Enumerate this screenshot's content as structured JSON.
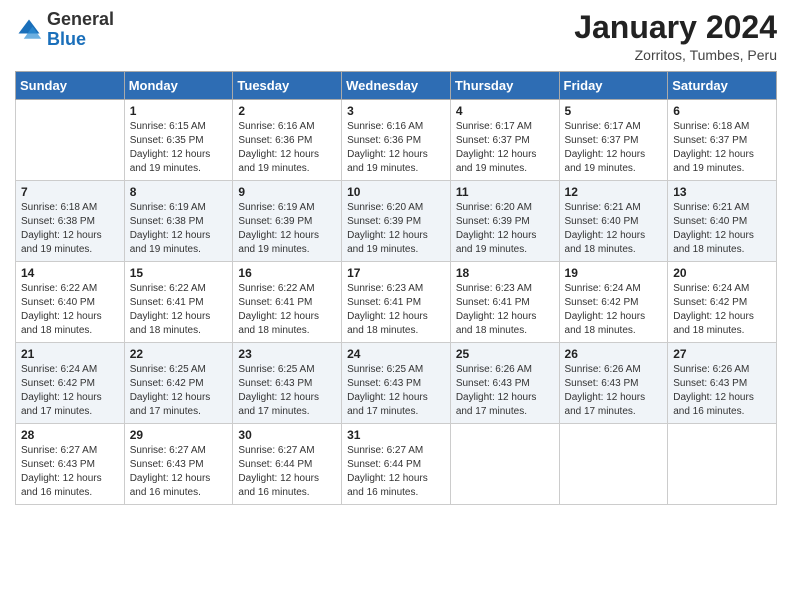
{
  "header": {
    "logo_general": "General",
    "logo_blue": "Blue",
    "month_title": "January 2024",
    "location": "Zorritos, Tumbes, Peru"
  },
  "weekdays": [
    "Sunday",
    "Monday",
    "Tuesday",
    "Wednesday",
    "Thursday",
    "Friday",
    "Saturday"
  ],
  "weeks": [
    [
      {
        "day": "",
        "info": ""
      },
      {
        "day": "1",
        "info": "Sunrise: 6:15 AM\nSunset: 6:35 PM\nDaylight: 12 hours and 19 minutes."
      },
      {
        "day": "2",
        "info": "Sunrise: 6:16 AM\nSunset: 6:36 PM\nDaylight: 12 hours and 19 minutes."
      },
      {
        "day": "3",
        "info": "Sunrise: 6:16 AM\nSunset: 6:36 PM\nDaylight: 12 hours and 19 minutes."
      },
      {
        "day": "4",
        "info": "Sunrise: 6:17 AM\nSunset: 6:37 PM\nDaylight: 12 hours and 19 minutes."
      },
      {
        "day": "5",
        "info": "Sunrise: 6:17 AM\nSunset: 6:37 PM\nDaylight: 12 hours and 19 minutes."
      },
      {
        "day": "6",
        "info": "Sunrise: 6:18 AM\nSunset: 6:37 PM\nDaylight: 12 hours and 19 minutes."
      }
    ],
    [
      {
        "day": "7",
        "info": "Sunrise: 6:18 AM\nSunset: 6:38 PM\nDaylight: 12 hours and 19 minutes."
      },
      {
        "day": "8",
        "info": "Sunrise: 6:19 AM\nSunset: 6:38 PM\nDaylight: 12 hours and 19 minutes."
      },
      {
        "day": "9",
        "info": "Sunrise: 6:19 AM\nSunset: 6:39 PM\nDaylight: 12 hours and 19 minutes."
      },
      {
        "day": "10",
        "info": "Sunrise: 6:20 AM\nSunset: 6:39 PM\nDaylight: 12 hours and 19 minutes."
      },
      {
        "day": "11",
        "info": "Sunrise: 6:20 AM\nSunset: 6:39 PM\nDaylight: 12 hours and 19 minutes."
      },
      {
        "day": "12",
        "info": "Sunrise: 6:21 AM\nSunset: 6:40 PM\nDaylight: 12 hours and 18 minutes."
      },
      {
        "day": "13",
        "info": "Sunrise: 6:21 AM\nSunset: 6:40 PM\nDaylight: 12 hours and 18 minutes."
      }
    ],
    [
      {
        "day": "14",
        "info": "Sunrise: 6:22 AM\nSunset: 6:40 PM\nDaylight: 12 hours and 18 minutes."
      },
      {
        "day": "15",
        "info": "Sunrise: 6:22 AM\nSunset: 6:41 PM\nDaylight: 12 hours and 18 minutes."
      },
      {
        "day": "16",
        "info": "Sunrise: 6:22 AM\nSunset: 6:41 PM\nDaylight: 12 hours and 18 minutes."
      },
      {
        "day": "17",
        "info": "Sunrise: 6:23 AM\nSunset: 6:41 PM\nDaylight: 12 hours and 18 minutes."
      },
      {
        "day": "18",
        "info": "Sunrise: 6:23 AM\nSunset: 6:41 PM\nDaylight: 12 hours and 18 minutes."
      },
      {
        "day": "19",
        "info": "Sunrise: 6:24 AM\nSunset: 6:42 PM\nDaylight: 12 hours and 18 minutes."
      },
      {
        "day": "20",
        "info": "Sunrise: 6:24 AM\nSunset: 6:42 PM\nDaylight: 12 hours and 18 minutes."
      }
    ],
    [
      {
        "day": "21",
        "info": "Sunrise: 6:24 AM\nSunset: 6:42 PM\nDaylight: 12 hours and 17 minutes."
      },
      {
        "day": "22",
        "info": "Sunrise: 6:25 AM\nSunset: 6:42 PM\nDaylight: 12 hours and 17 minutes."
      },
      {
        "day": "23",
        "info": "Sunrise: 6:25 AM\nSunset: 6:43 PM\nDaylight: 12 hours and 17 minutes."
      },
      {
        "day": "24",
        "info": "Sunrise: 6:25 AM\nSunset: 6:43 PM\nDaylight: 12 hours and 17 minutes."
      },
      {
        "day": "25",
        "info": "Sunrise: 6:26 AM\nSunset: 6:43 PM\nDaylight: 12 hours and 17 minutes."
      },
      {
        "day": "26",
        "info": "Sunrise: 6:26 AM\nSunset: 6:43 PM\nDaylight: 12 hours and 17 minutes."
      },
      {
        "day": "27",
        "info": "Sunrise: 6:26 AM\nSunset: 6:43 PM\nDaylight: 12 hours and 16 minutes."
      }
    ],
    [
      {
        "day": "28",
        "info": "Sunrise: 6:27 AM\nSunset: 6:43 PM\nDaylight: 12 hours and 16 minutes."
      },
      {
        "day": "29",
        "info": "Sunrise: 6:27 AM\nSunset: 6:43 PM\nDaylight: 12 hours and 16 minutes."
      },
      {
        "day": "30",
        "info": "Sunrise: 6:27 AM\nSunset: 6:44 PM\nDaylight: 12 hours and 16 minutes."
      },
      {
        "day": "31",
        "info": "Sunrise: 6:27 AM\nSunset: 6:44 PM\nDaylight: 12 hours and 16 minutes."
      },
      {
        "day": "",
        "info": ""
      },
      {
        "day": "",
        "info": ""
      },
      {
        "day": "",
        "info": ""
      }
    ]
  ]
}
